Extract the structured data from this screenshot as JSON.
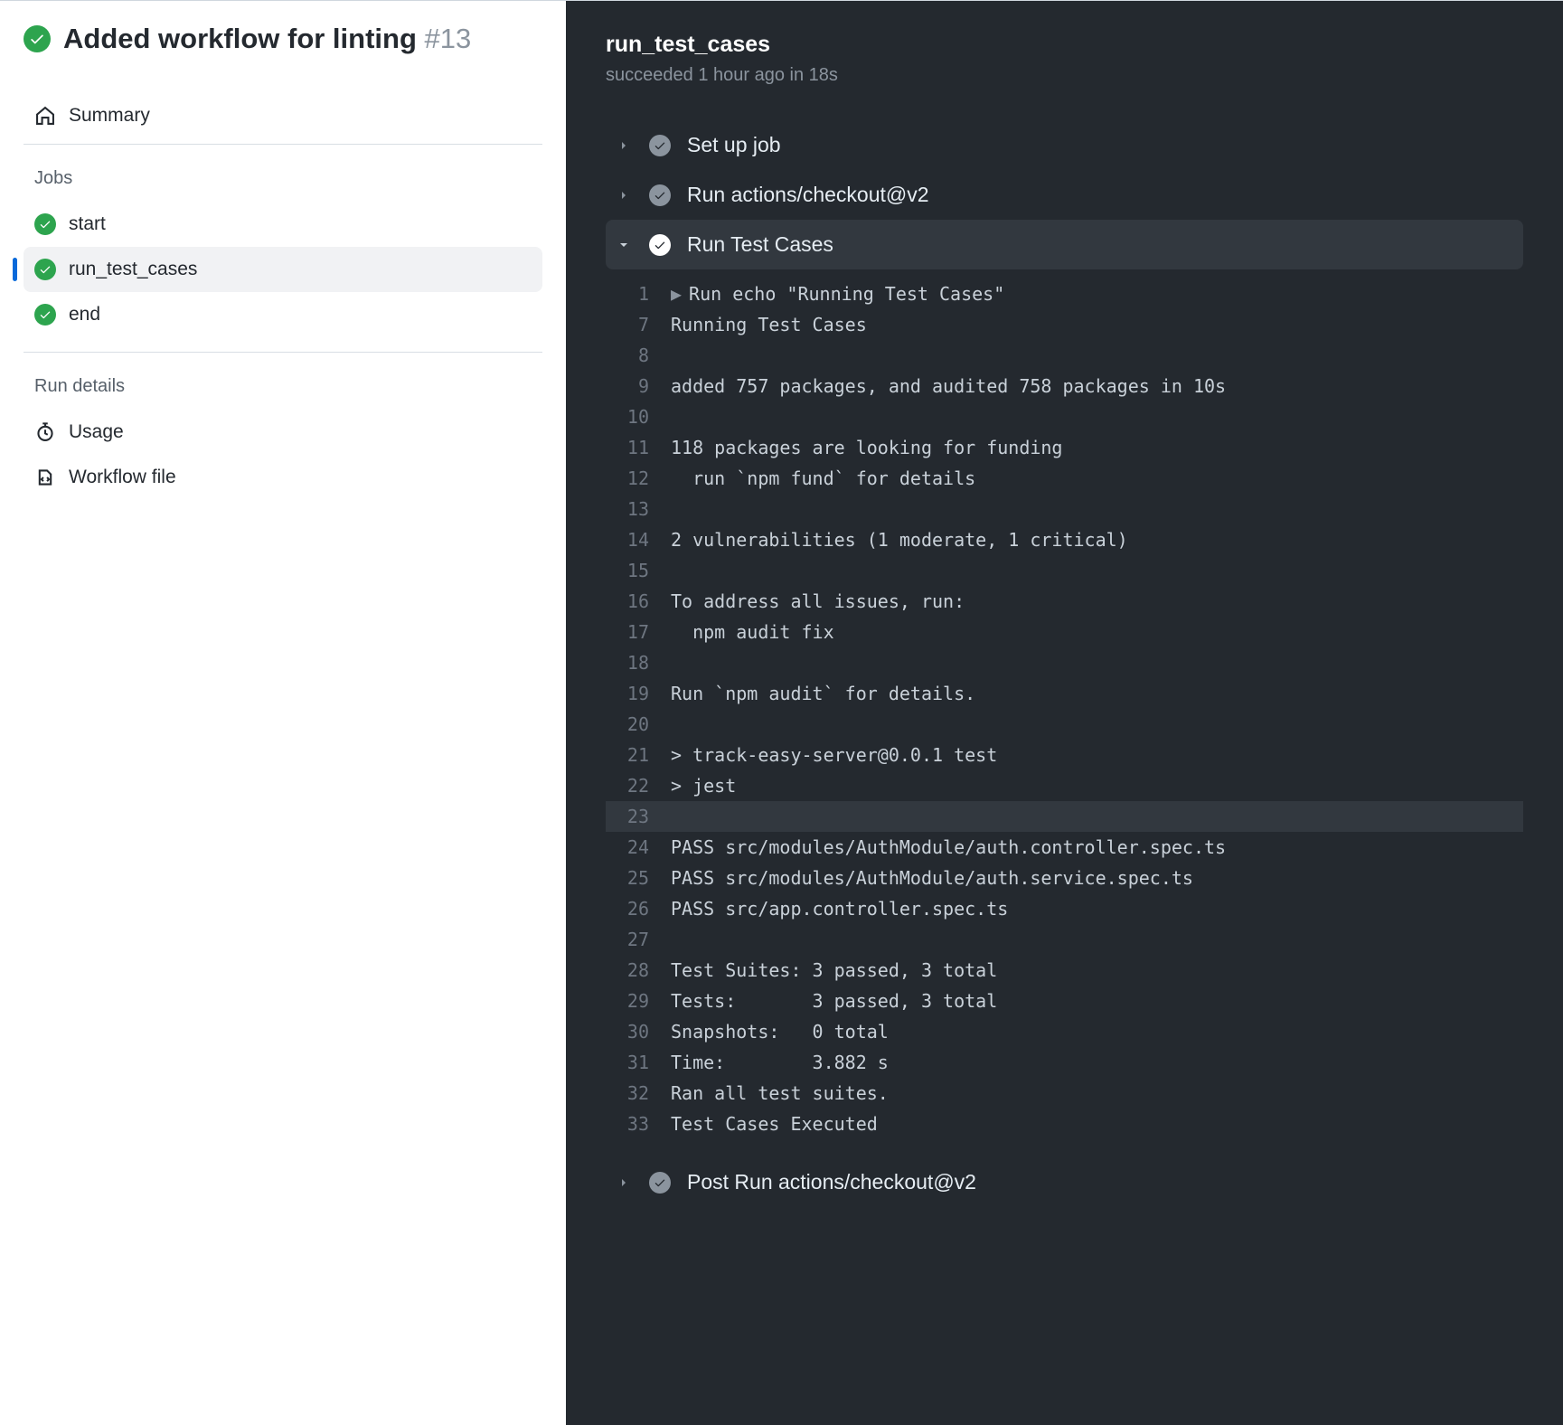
{
  "header": {
    "title": "Added workflow for linting",
    "run_number": "#13"
  },
  "sidebar": {
    "summary_label": "Summary",
    "jobs_label": "Jobs",
    "jobs": [
      {
        "name": "start",
        "selected": false
      },
      {
        "name": "run_test_cases",
        "selected": true
      },
      {
        "name": "end",
        "selected": false
      }
    ],
    "run_details_label": "Run details",
    "usage_label": "Usage",
    "workflow_file_label": "Workflow file"
  },
  "job": {
    "name": "run_test_cases",
    "status_prefix": "succeeded",
    "status_time": "1 hour ago",
    "status_duration": "in 18s"
  },
  "steps": [
    {
      "name": "Set up job",
      "status": "success",
      "expanded": false
    },
    {
      "name": "Run actions/checkout@v2",
      "status": "success",
      "expanded": false
    },
    {
      "name": "Run Test Cases",
      "status": "success",
      "expanded": true
    },
    {
      "name": "Post Run actions/checkout@v2",
      "status": "success",
      "expanded": false
    }
  ],
  "log": [
    {
      "n": 1,
      "t": "Run echo \"Running Test Cases\"",
      "cmd": true
    },
    {
      "n": 7,
      "t": "Running Test Cases"
    },
    {
      "n": 8,
      "t": ""
    },
    {
      "n": 9,
      "t": "added 757 packages, and audited 758 packages in 10s"
    },
    {
      "n": 10,
      "t": ""
    },
    {
      "n": 11,
      "t": "118 packages are looking for funding"
    },
    {
      "n": 12,
      "t": "  run `npm fund` for details"
    },
    {
      "n": 13,
      "t": ""
    },
    {
      "n": 14,
      "t": "2 vulnerabilities (1 moderate, 1 critical)"
    },
    {
      "n": 15,
      "t": ""
    },
    {
      "n": 16,
      "t": "To address all issues, run:"
    },
    {
      "n": 17,
      "t": "  npm audit fix"
    },
    {
      "n": 18,
      "t": ""
    },
    {
      "n": 19,
      "t": "Run `npm audit` for details."
    },
    {
      "n": 20,
      "t": ""
    },
    {
      "n": 21,
      "t": "> track-easy-server@0.0.1 test"
    },
    {
      "n": 22,
      "t": "> jest"
    },
    {
      "n": 23,
      "t": "",
      "hl": true
    },
    {
      "n": 24,
      "t": "PASS src/modules/AuthModule/auth.controller.spec.ts"
    },
    {
      "n": 25,
      "t": "PASS src/modules/AuthModule/auth.service.spec.ts"
    },
    {
      "n": 26,
      "t": "PASS src/app.controller.spec.ts"
    },
    {
      "n": 27,
      "t": ""
    },
    {
      "n": 28,
      "t": "Test Suites: 3 passed, 3 total"
    },
    {
      "n": 29,
      "t": "Tests:       3 passed, 3 total"
    },
    {
      "n": 30,
      "t": "Snapshots:   0 total"
    },
    {
      "n": 31,
      "t": "Time:        3.882 s"
    },
    {
      "n": 32,
      "t": "Ran all test suites."
    },
    {
      "n": 33,
      "t": "Test Cases Executed"
    }
  ]
}
